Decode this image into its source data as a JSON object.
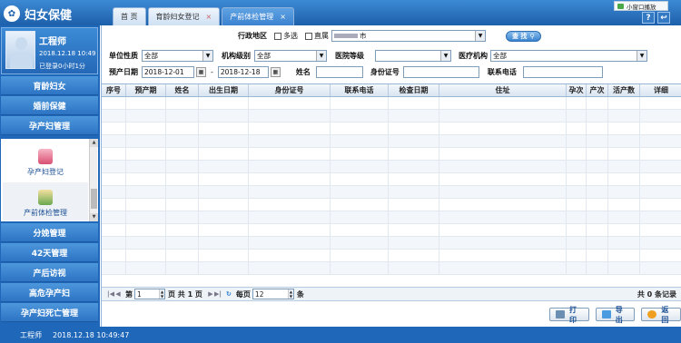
{
  "app": {
    "title": "妇女保健",
    "logo_icon": "emblem-icon"
  },
  "tabs": [
    {
      "label": "首 页",
      "closable": false,
      "active": false
    },
    {
      "label": "育龄妇女登记",
      "closable": true,
      "active": false
    },
    {
      "label": "产前体检管理",
      "closable": true,
      "active": true
    }
  ],
  "mini_window": {
    "label": "小窗口播放"
  },
  "top_icons": [
    {
      "name": "help-icon",
      "glyph": "?"
    },
    {
      "name": "exit-icon",
      "glyph": "↩"
    }
  ],
  "profile": {
    "name": "工程师",
    "date": "2018.12.18 10:49",
    "login_duration": "已登录0小时1分"
  },
  "sidebar": {
    "items_top": [
      "育龄妇女",
      "婚前保健",
      "孕产妇管理"
    ],
    "sub_items": [
      {
        "label": "孕产妇登记",
        "icon": "pregnant-woman-icon"
      },
      {
        "label": "产前体检管理",
        "icon": "checkup-icon",
        "selected": true
      }
    ],
    "items_bottom": [
      "分娩管理",
      "42天管理",
      "产后访视",
      "高危孕产妇",
      "孕产妇死亡管理"
    ]
  },
  "filters": {
    "region_label": "行政地区",
    "multi_label": "多选",
    "direct_label": "直属",
    "region_value": "市",
    "search_button": "查 找",
    "unit_type_label": "单位性质",
    "unit_type_value": "全部",
    "org_level_label": "机构级别",
    "org_level_value": "全部",
    "hospital_level_label": "医院等级",
    "hospital_level_value": "",
    "medical_org_label": "医疗机构",
    "medical_org_value": "全部",
    "due_date_label": "预产日期",
    "due_from": "2018-12-01",
    "due_to": "2018-12-18",
    "dash": "-",
    "name_label": "姓名",
    "name_value": "",
    "id_label": "身份证号",
    "id_value": "",
    "phone_label": "联系电话",
    "phone_value": ""
  },
  "table": {
    "columns": [
      "序号",
      "预产期",
      "姓名",
      "出生日期",
      "身份证号",
      "联系电话",
      "检查日期",
      "住址",
      "孕次",
      "产次",
      "活产数",
      "详细"
    ],
    "rows": []
  },
  "pager": {
    "page_label": "第",
    "page_value": "1",
    "total_label": "页 共 1 页",
    "per_page_label": "每页",
    "per_page_value": "12",
    "per_page_unit": "条",
    "total_records": "共 0 条记录"
  },
  "actions": {
    "print": "打印",
    "export": "导出",
    "back": "返回"
  },
  "status": {
    "user": "工程师",
    "datetime": "2018.12.18 10:49:47"
  },
  "colors": {
    "brand": "#1f67b9",
    "header": "#3d8ad4",
    "active_tab": "#3c82cf"
  }
}
